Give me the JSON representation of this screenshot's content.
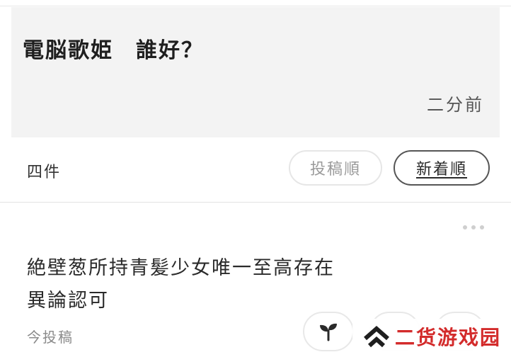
{
  "header": {
    "title": "電脳歌姫　誰好？",
    "timestamp": "二分前"
  },
  "toolbar": {
    "count_label": "四件",
    "sort_options": [
      {
        "label": "投稿順",
        "selected": false
      },
      {
        "label": "新着順",
        "selected": true
      }
    ]
  },
  "post": {
    "line1": "絶壁葱所持青髪少女唯一至高存在",
    "line2": "異論認可",
    "time": "今投稿",
    "reactions": [
      {
        "icon": "sprout-icon",
        "color": "#2a2a2a"
      },
      {
        "icon": "reaction-icon"
      },
      {
        "icon": "reaction-icon"
      }
    ],
    "more_icon": "more-dots-icon"
  },
  "watermark": {
    "text": "二货游戏园",
    "color": "#d32b2b",
    "icon": "double-chevron-up-icon"
  }
}
